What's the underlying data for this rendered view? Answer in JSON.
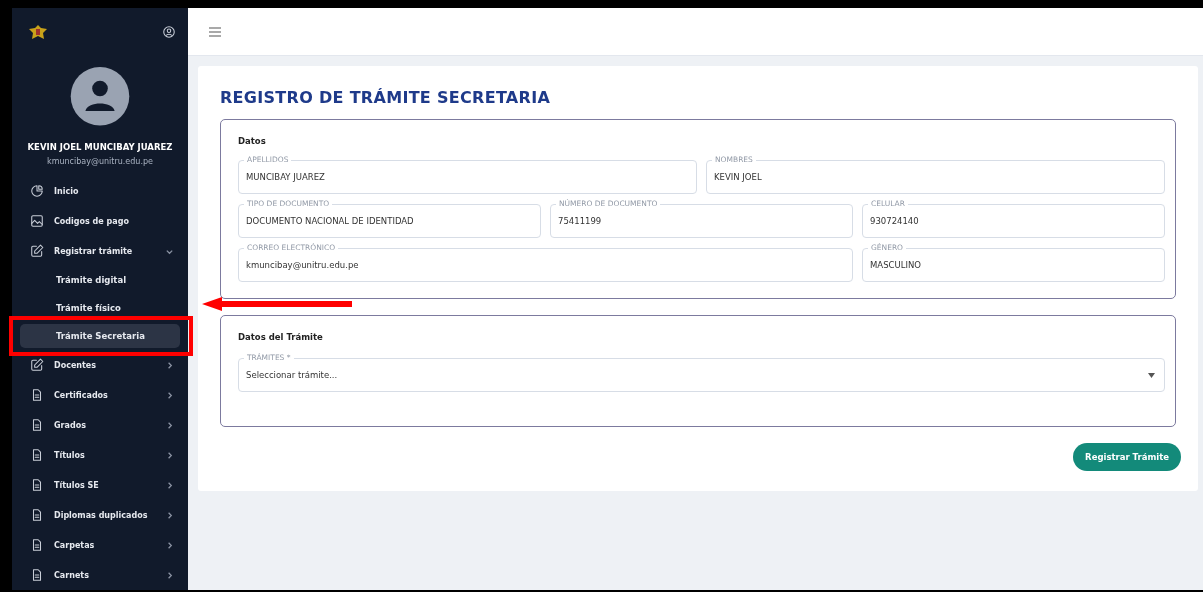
{
  "user": {
    "name": "KEVIN JOEL MUNCIBAY JUAREZ",
    "email": "kmuncibay@unitru.edu.pe"
  },
  "sidebar": {
    "items": [
      {
        "kind": "link",
        "label": "Inicio"
      },
      {
        "kind": "link",
        "label": "Codigos de pago"
      },
      {
        "kind": "menu",
        "label": "Registrar trámite",
        "expanded": true,
        "children": [
          {
            "label": "Trámite digital",
            "selected": false
          },
          {
            "label": "Trámite físico",
            "selected": false
          },
          {
            "label": "Trámite Secretaria",
            "selected": true
          }
        ]
      },
      {
        "kind": "menu",
        "label": "Docentes",
        "expanded": false
      },
      {
        "kind": "menu",
        "label": "Certificados",
        "expanded": false
      },
      {
        "kind": "menu",
        "label": "Grados",
        "expanded": false
      },
      {
        "kind": "menu",
        "label": "Títulos",
        "expanded": false
      },
      {
        "kind": "menu",
        "label": "Títulos SE",
        "expanded": false
      },
      {
        "kind": "menu",
        "label": "Diplomas duplicados",
        "expanded": false
      },
      {
        "kind": "menu",
        "label": "Carpetas",
        "expanded": false
      },
      {
        "kind": "menu",
        "label": "Carnets",
        "expanded": false
      }
    ]
  },
  "page_title": "REGISTRO DE TRÁMITE SECRETARIA",
  "datos": {
    "title": "Datos",
    "fields": [
      {
        "label": "APELLIDOS",
        "value": "MUNCIBAY JUAREZ"
      },
      {
        "label": "NOMBRES",
        "value": "KEVIN JOEL"
      },
      {
        "label": "TIPO DE DOCUMENTO",
        "value": "DOCUMENTO NACIONAL DE IDENTIDAD"
      },
      {
        "label": "NÚMERO DE DOCUMENTO",
        "value": "75411199"
      },
      {
        "label": "CELULAR",
        "value": "930724140"
      },
      {
        "label": "CORREO ELECTRÓNICO",
        "value": "kmuncibay@unitru.edu.pe"
      },
      {
        "label": "GÉNERO",
        "value": "MASCULINO"
      }
    ]
  },
  "tramite": {
    "title": "Datos del Trámite",
    "select": {
      "label": "TRÁMITES *",
      "placeholder": "Seleccionar trámite..."
    }
  },
  "submit": "Registrar Trámite"
}
